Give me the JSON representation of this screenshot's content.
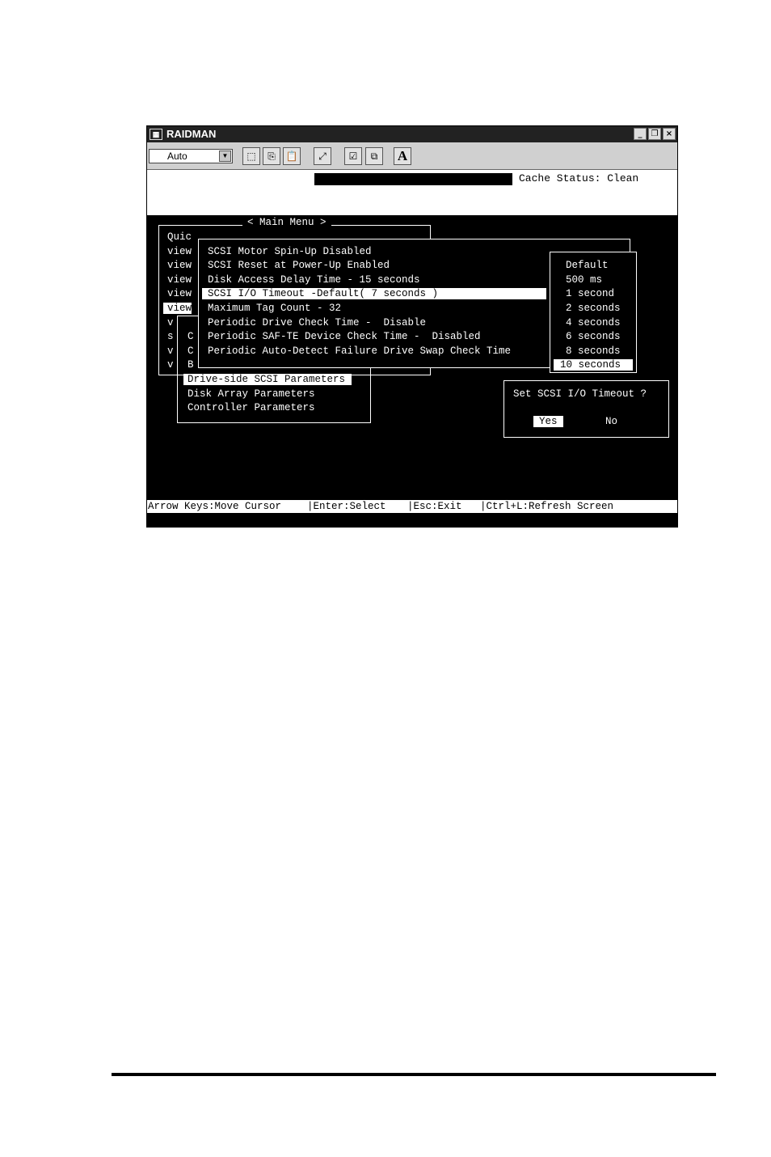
{
  "window": {
    "title": "RAIDMAN",
    "app_icon": "raidman-icon"
  },
  "toolbar": {
    "combo_value": "Auto",
    "font_button": "A"
  },
  "status": {
    "cache_status": "Cache Status: Clean"
  },
  "terminal": {
    "main_menu_title": "< Main Menu >",
    "left_fragments": [
      "Quic",
      "view",
      "view",
      "view",
      "view",
      "view",
      "v",
      "s",
      "v",
      "v"
    ],
    "left_inner": [
      "C",
      "C",
      "B"
    ],
    "param_items": [
      "SCSI Motor Spin-Up Disabled",
      "SCSI Reset at Power-Up Enabled",
      "Disk Access Delay Time - 15 seconds",
      "SCSI I/O Timeout -Default( 7 seconds )",
      "Maximum Tag Count - 32",
      "Periodic Drive Check Time -  Disable",
      "Periodic SAF-TE Device Check Time -  Disabled",
      "Periodic Auto-Detect Failure Drive Swap Check Time"
    ],
    "timeout_options": [
      "Default",
      "500 ms",
      "1 second",
      "2 seconds",
      "4 seconds",
      "6 seconds",
      "8 seconds",
      "10 seconds"
    ],
    "config_items": [
      "Drive-side SCSI Parameters",
      "Disk Array Parameters",
      "Controller Parameters"
    ],
    "dialog": {
      "prompt": "Set SCSI I/O Timeout ?",
      "yes": "Yes",
      "no": "No"
    }
  },
  "footer": {
    "keys": [
      "Arrow Keys:Move Cursor",
      "|Enter:Select",
      "|Esc:Exit",
      "|Ctrl+L:Refresh Screen"
    ]
  }
}
